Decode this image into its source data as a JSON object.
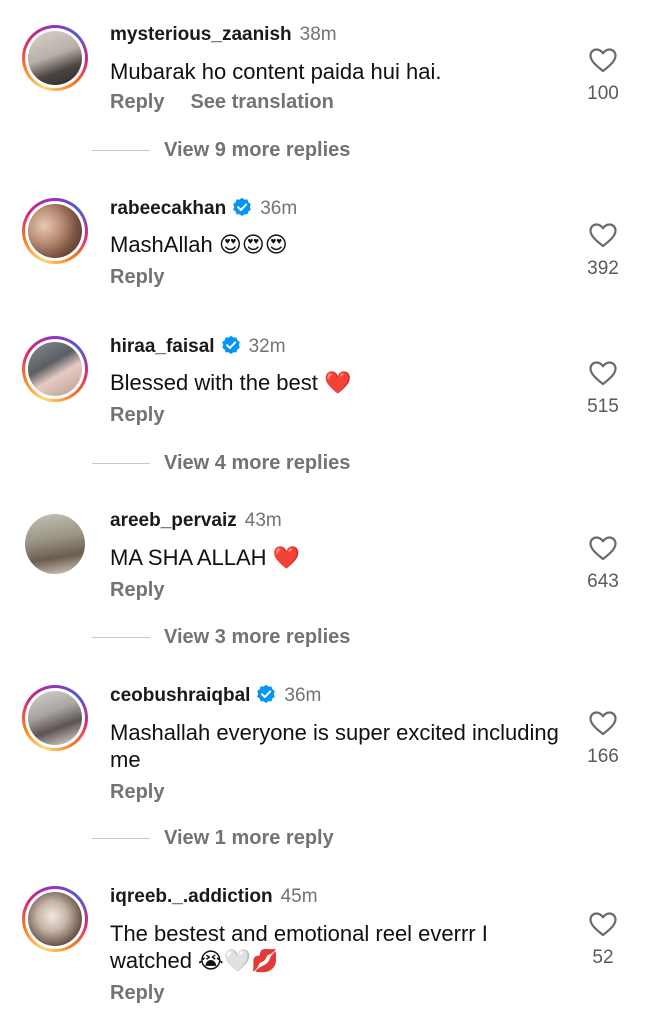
{
  "comments": [
    {
      "username": "mysterious_zaanish",
      "time": "38m",
      "verified": false,
      "text": "Mubarak ho content paida hui hai.",
      "reply": "Reply",
      "translate": "See translation",
      "likes": "100",
      "more_replies": "View 9 more replies"
    },
    {
      "username": "rabeecakhan",
      "time": "36m",
      "verified": true,
      "text": "MashAllah 😍😍😍",
      "reply": "Reply",
      "likes": "392"
    },
    {
      "username": "hiraa_faisal",
      "time": "32m",
      "verified": true,
      "text": "Blessed with the best ❤️",
      "reply": "Reply",
      "likes": "515",
      "more_replies": "View 4 more replies"
    },
    {
      "username": "areeb_pervaiz",
      "time": "43m",
      "verified": false,
      "text": "MA SHA ALLAH ❤️",
      "reply": "Reply",
      "likes": "643",
      "more_replies": "View 3 more replies"
    },
    {
      "username": "ceobushraiqbal",
      "time": "36m",
      "verified": true,
      "text": "Mashallah everyone is super excited including me",
      "reply": "Reply",
      "likes": "166",
      "more_replies": "View 1 more reply"
    },
    {
      "username": "iqreeb._.addiction",
      "time": "45m",
      "verified": false,
      "text": "The bestest and emotional reel everrr I watched 😭🤍💋",
      "reply": "Reply",
      "likes": "52"
    }
  ],
  "colors": {
    "verified": "#0095f6",
    "muted": "#737373",
    "heart_red": "#ed1c3a"
  },
  "icons": {
    "like": "heart-outline-icon",
    "verified": "verified-badge-icon"
  }
}
